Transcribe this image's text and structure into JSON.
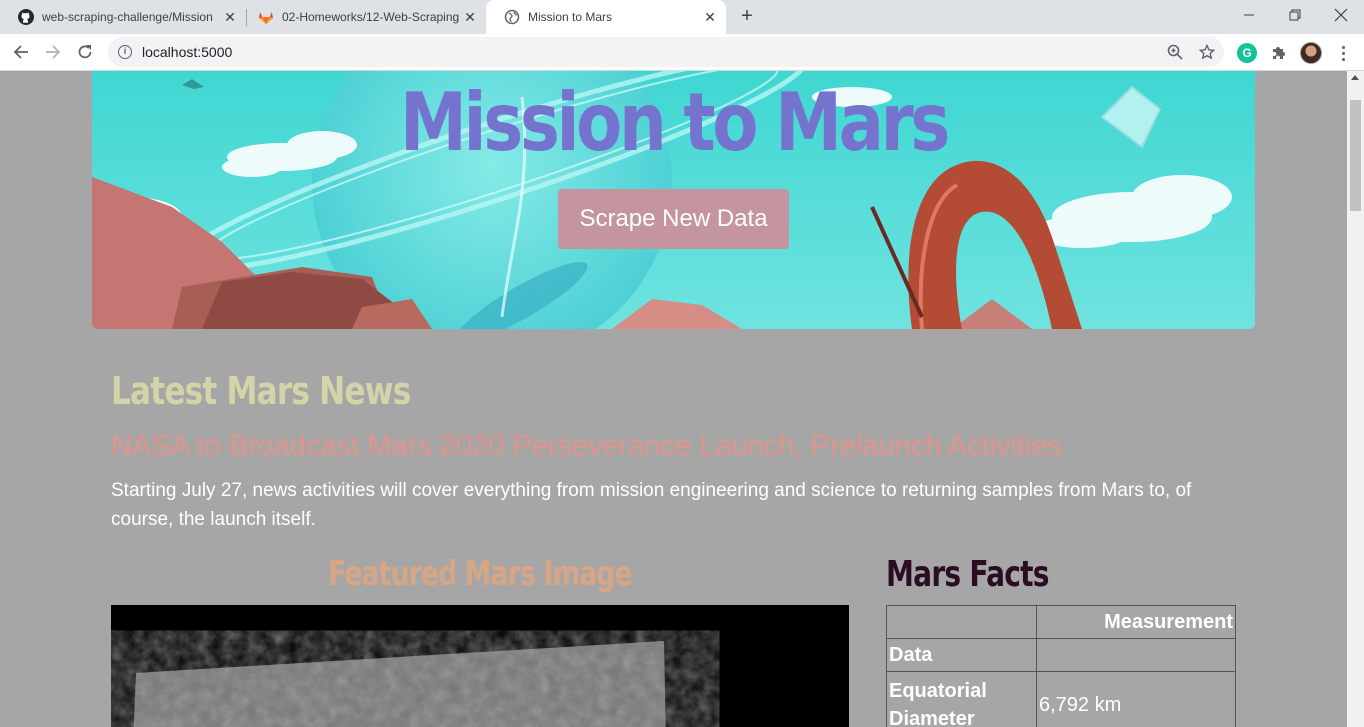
{
  "browser": {
    "tabs": [
      {
        "title": "web-scraping-challenge/Mission",
        "favicon": "github-icon"
      },
      {
        "title": "02-Homeworks/12-Web-Scraping",
        "favicon": "gitlab-icon"
      },
      {
        "title": "Mission to Mars",
        "favicon": "globe-icon",
        "active": true
      }
    ],
    "url": "localhost:5000"
  },
  "page": {
    "jumbotron": {
      "title": "Mission to Mars",
      "button_label": "Scrape New Data"
    },
    "news": {
      "heading": "Latest Mars News",
      "title": "NASA to Broadcast Mars 2020 Perseverance Launch, Prelaunch Activities",
      "paragraph": "Starting July 27, news activities will cover everything from mission engineering and science to returning samples from Mars to, of course, the launch itself."
    },
    "featured": {
      "heading": "Featured Mars Image"
    },
    "facts": {
      "heading": "Mars Facts",
      "column_header": "Measurement",
      "rows": [
        {
          "label": "Data",
          "value": ""
        },
        {
          "label": "Equatorial Diameter",
          "value": "6,792 km"
        }
      ]
    }
  },
  "colors": {
    "page_bg": "#a6a6a6",
    "title": "#7474cf",
    "button": "#c4959f",
    "news_heading": "#d4d4a8",
    "news_title": "#e3948a",
    "featured_heading": "#d8a585",
    "facts_heading": "#2a0d22"
  }
}
